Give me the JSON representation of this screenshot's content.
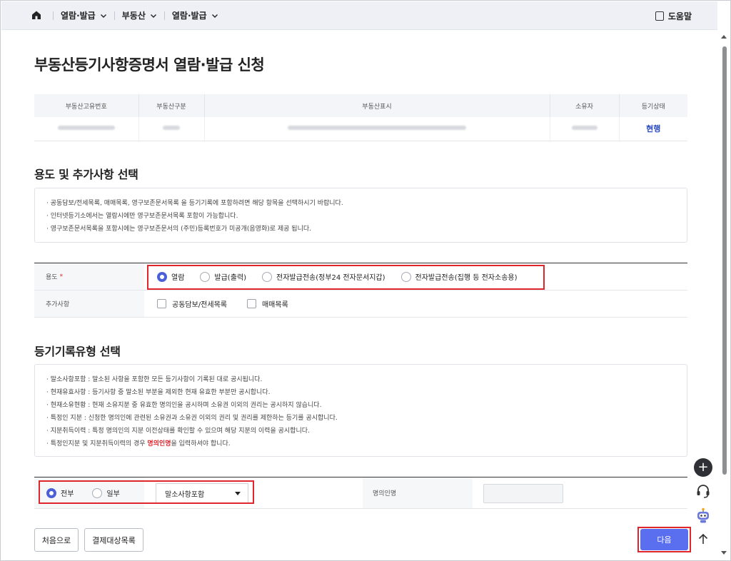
{
  "nav": {
    "items": [
      {
        "label": "열람·발급"
      },
      {
        "label": "부동산"
      },
      {
        "label": "열람·발급"
      }
    ],
    "help_label": "도움말"
  },
  "page": {
    "title": "부동산등기사항증명서 열람·발급 신청"
  },
  "property_table": {
    "headers": [
      "부동산고유번호",
      "부동산구분",
      "부동산표시",
      "소유자",
      "등기상태"
    ],
    "status_value": "현행"
  },
  "usage_section": {
    "title": "용도 및 추가사항 선택",
    "notices": [
      "· 공동담보/전세목록, 매매목록, 영구보존문서목록 을 등기기록에 포함하려면 해당 항목을 선택하시기 바랍니다.",
      "· 인터넷등기소에서는 열람시에만 영구보존문서목록 포함이 가능합니다.",
      "· 영구보존문서목록을 포함시에는 영구보존문서의 (주민)등록번호가 미공개(음영화)로 제공 됩니다."
    ],
    "usage_label": "용도",
    "required_mark": "*",
    "usage_options": [
      {
        "label": "열람",
        "selected": true
      },
      {
        "label": "발급(출력)",
        "selected": false
      },
      {
        "label": "전자발급전송(정부24 전자문서지갑)",
        "selected": false
      },
      {
        "label": "전자발급전송(집행 등 전자소송용)",
        "selected": false
      }
    ],
    "extra_label": "추가사항",
    "extra_options": [
      {
        "label": "공동담보/전세목록",
        "checked": false
      },
      {
        "label": "매매목록",
        "checked": false
      }
    ]
  },
  "record_section": {
    "title": "등기기록유형 선택",
    "notices": [
      "· 말소사항포함 : 말소된 사항을 포함한 모든 등기사항이 기록된 대로 공시됩니다.",
      "· 현재유효사항 : 등기사항 중 말소된 부분을 제외한 현재 유효한 부분만 공시합니다.",
      "· 현재소유현황 : 현재 소유지분 중 유효한 명의인을 공시하며 소유권 이외의 권리는 공시하지 않습니다.",
      "· 특정인 지분 : 신청한 명의인에 관련된 소유권과 소유권 이외의 권리 및 권리를 제한하는 등기를 공시합니다.",
      "· 지분취득이력 : 특정 명의인의 지분 이전상태를 확인할 수 있으며 해당 지분의 이력을 공시합니다."
    ],
    "last_notice_pre": "· 특정인지분 및 지분취득이력의 경우 ",
    "last_notice_em": "명의인명",
    "last_notice_post": "을 입력하셔야 합니다.",
    "scope_options": [
      {
        "label": "전부",
        "selected": true
      },
      {
        "label": "일부",
        "selected": false
      }
    ],
    "record_type_value": "말소사항포함",
    "name_label": "명의인명",
    "name_value": ""
  },
  "buttons": {
    "first": "처음으로",
    "payment_list": "결제대상목록",
    "next": "다음"
  },
  "colors": {
    "accent": "#5a6ef0",
    "highlight": "#e0262d",
    "status_link": "#2948c2"
  }
}
